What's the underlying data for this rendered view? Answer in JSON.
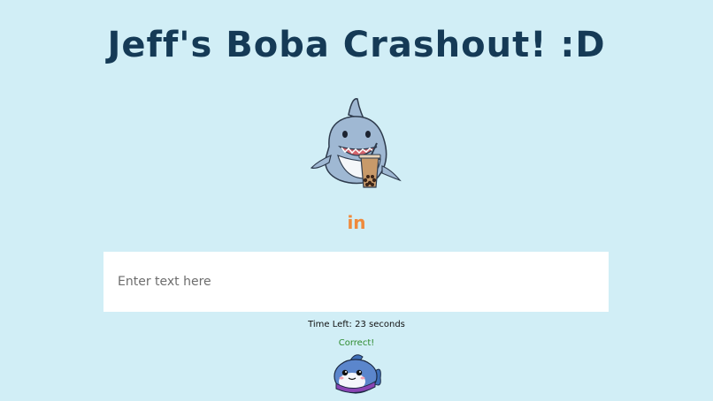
{
  "game": {
    "title": "Jeff's Boba Crashout! :D",
    "current_word": "in",
    "input": {
      "value": "",
      "placeholder": "Enter text here"
    },
    "timer_text": "Time Left: 23 seconds",
    "feedback_text": "Correct!",
    "mascot_icon": "shark-boba-icon",
    "result_icon": "fish-icon"
  },
  "colors": {
    "background": "#d1eef6",
    "title": "#153a56",
    "word": "#ef8a3c",
    "feedback": "#2e8b2e"
  }
}
